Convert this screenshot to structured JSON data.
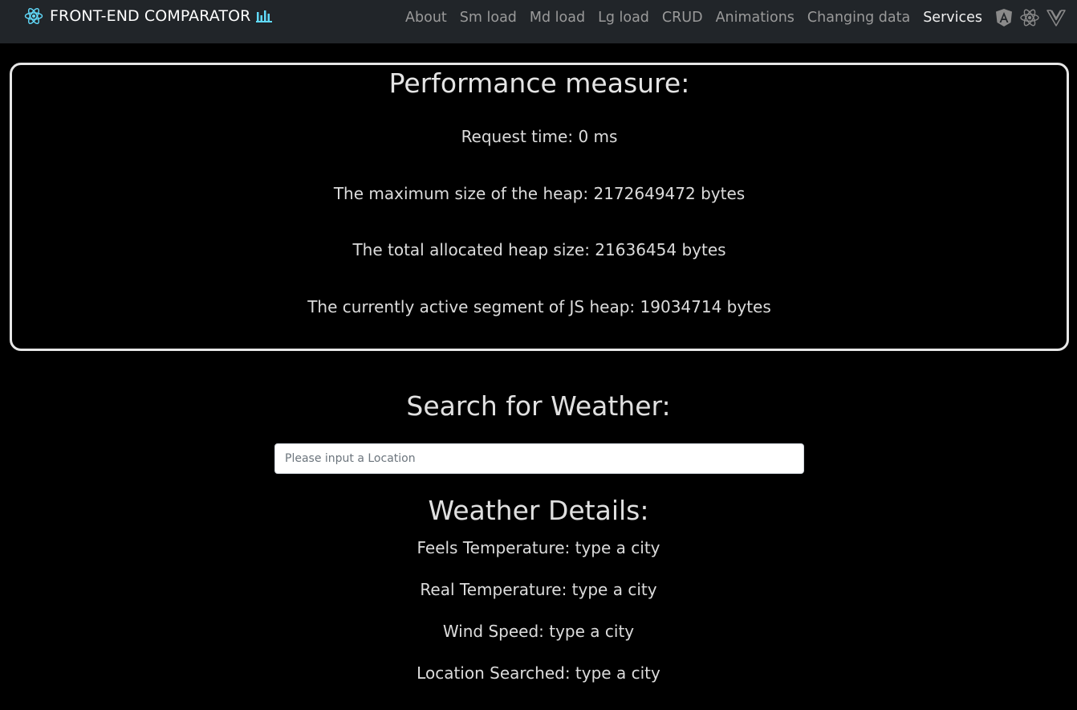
{
  "navbar": {
    "brand": "FRONT-END COMPARATOR",
    "links": [
      "About",
      "Sm load",
      "Md load",
      "Lg load",
      "CRUD",
      "Animations",
      "Changing data",
      "Services"
    ],
    "active_link": "Services",
    "brand_icon": "react-atom-icon",
    "brand_badge_icon": "bar-chart-icon",
    "framework_icons": [
      "angular-icon",
      "react-icon",
      "vue-icon"
    ],
    "colors": {
      "background": "#212529",
      "react_blue": "#61dafb"
    }
  },
  "performance": {
    "title": "Performance measure:",
    "request_time": "Request time: 0 ms",
    "heap_max": "The maximum size of the heap: 2172649472 bytes",
    "heap_total": "The total allocated heap size: 21636454 bytes",
    "heap_active": "The currently active segment of JS heap: 19034714 bytes"
  },
  "search": {
    "title": "Search for Weather:",
    "placeholder": "Please input a Location",
    "value": ""
  },
  "weather": {
    "title": "Weather Details:",
    "feels": "Feels Temperature: type a city",
    "real": "Real Temperature: type a city",
    "wind": "Wind Speed: type a city",
    "location": "Location Searched: type a city"
  }
}
